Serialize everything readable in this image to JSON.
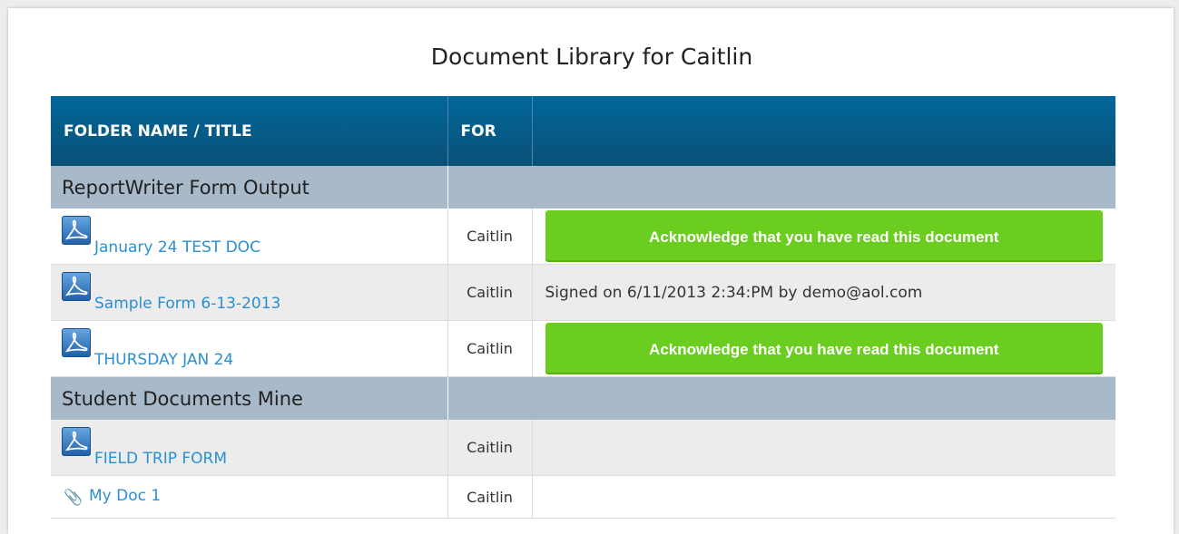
{
  "page": {
    "title": "Document Library for Caitlin"
  },
  "table": {
    "headers": [
      "FOLDER NAME / TITLE",
      "FOR",
      ""
    ],
    "folders": [
      {
        "name": "ReportWriter Form Output",
        "docs": [
          {
            "title": "January 24 TEST DOC",
            "icon": "pdf-icon",
            "for": "Caitlin",
            "action_type": "button",
            "action": "Acknowledge that you have read this document"
          },
          {
            "title": "Sample Form 6-13-2013",
            "icon": "pdf-icon",
            "for": "Caitlin",
            "action_type": "text",
            "action": "Signed on 6/11/2013 2:34:PM by demo@aol.com"
          },
          {
            "title": "THURSDAY JAN 24",
            "icon": "pdf-icon",
            "for": "Caitlin",
            "action_type": "button",
            "action": "Acknowledge that you have read this document"
          }
        ]
      },
      {
        "name": "Student Documents Mine",
        "docs": [
          {
            "title": "FIELD TRIP FORM",
            "icon": "pdf-icon",
            "for": "Caitlin",
            "action_type": "none",
            "action": ""
          },
          {
            "title": "My Doc 1",
            "icon": "paperclip-icon",
            "for": "Caitlin",
            "action_type": "none",
            "action": ""
          }
        ]
      }
    ]
  },
  "colors": {
    "header_bg": "#01679a",
    "folder_row_bg": "#a8b9c9",
    "link": "#2a8fd0",
    "ack_button": "#6acd1f"
  }
}
